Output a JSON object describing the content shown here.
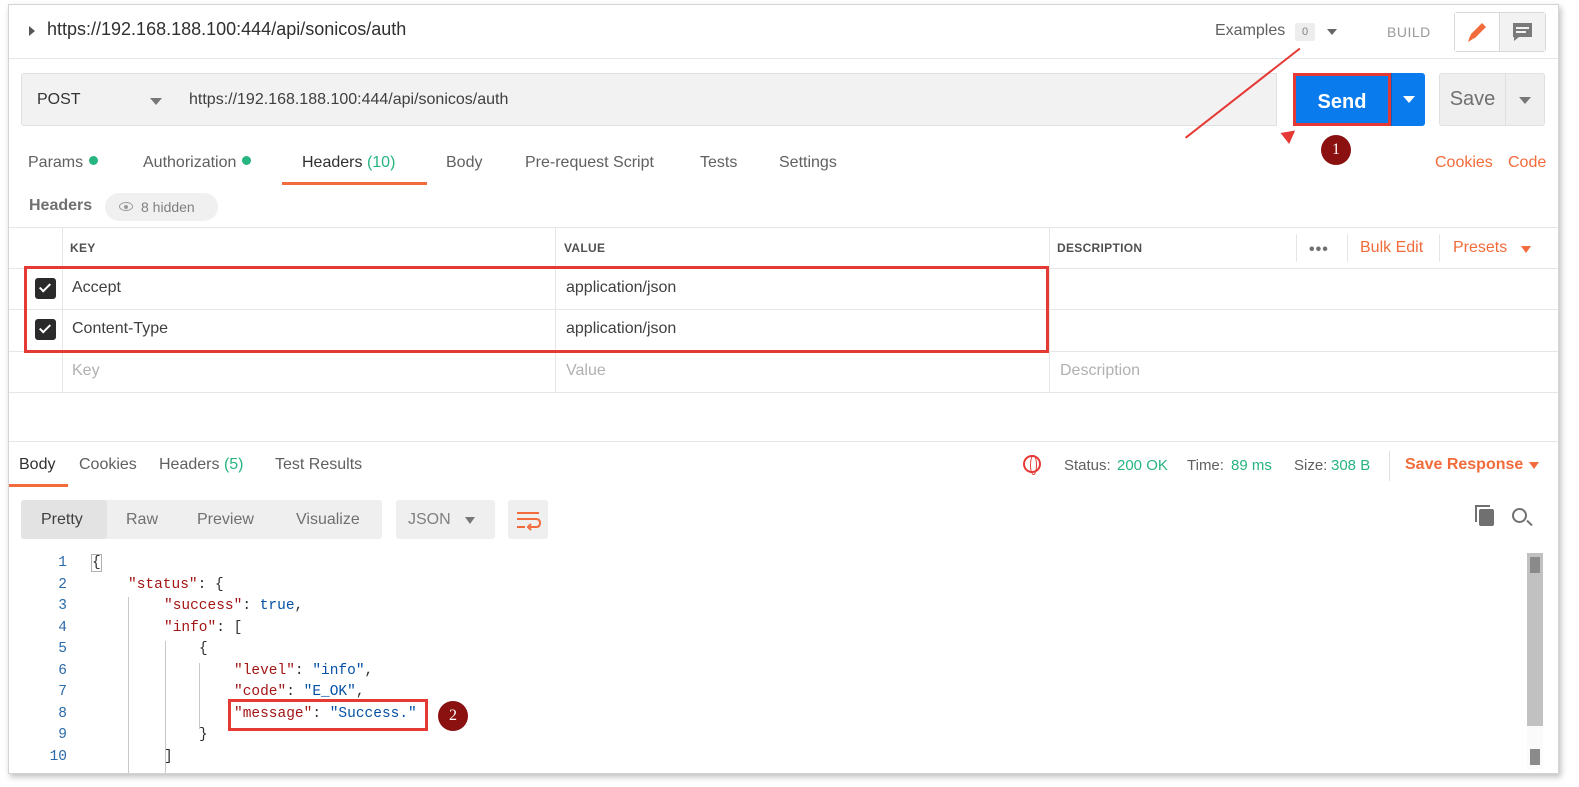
{
  "titlebar": {
    "url": "https://192.168.188.100:444/api/sonicos/auth",
    "examples_label": "Examples",
    "examples_count": "0",
    "build_label": "BUILD"
  },
  "request": {
    "method": "POST",
    "url": "https://192.168.188.100:444/api/sonicos/auth",
    "send_label": "Send",
    "save_label": "Save"
  },
  "annotations": {
    "one": "1",
    "two": "2"
  },
  "tabs": {
    "params": "Params",
    "authorization": "Authorization",
    "headers": "Headers",
    "headers_count": "(10)",
    "body": "Body",
    "pre_request": "Pre-request Script",
    "tests": "Tests",
    "settings": "Settings",
    "cookies_link": "Cookies",
    "code_link": "Code"
  },
  "headers_section": {
    "title": "Headers",
    "hidden": "8 hidden",
    "columns": {
      "key": "KEY",
      "value": "VALUE",
      "description": "DESCRIPTION"
    },
    "bulk_edit": "Bulk Edit",
    "presets": "Presets",
    "rows": [
      {
        "key": "Accept",
        "value": "application/json",
        "checked": true
      },
      {
        "key": "Content-Type",
        "value": "application/json",
        "checked": true
      }
    ],
    "placeholders": {
      "key": "Key",
      "value": "Value",
      "description": "Description"
    }
  },
  "response": {
    "tabs": {
      "body": "Body",
      "cookies": "Cookies",
      "headers": "Headers",
      "headers_count": "(5)",
      "test_results": "Test Results"
    },
    "status_label": "Status:",
    "status_value": "200 OK",
    "time_label": "Time:",
    "time_value": "89 ms",
    "size_label": "Size:",
    "size_value": "308 B",
    "save_response": "Save Response",
    "formats": {
      "pretty": "Pretty",
      "raw": "Raw",
      "preview": "Preview",
      "visualize": "Visualize"
    },
    "language": "JSON"
  },
  "code": {
    "line_numbers": [
      "1",
      "2",
      "3",
      "4",
      "5",
      "6",
      "7",
      "8",
      "9",
      "10"
    ],
    "tokens": {
      "status": "\"status\"",
      "success": "\"success\"",
      "true": "true",
      "info": "\"info\"",
      "level": "\"level\"",
      "level_val": "\"info\"",
      "code": "\"code\"",
      "code_val": "\"E_OK\"",
      "message": "\"message\"",
      "message_val": "\"Success.\""
    }
  },
  "colors": {
    "send_blue": "#097bed",
    "accent_orange": "#f26b3a",
    "status_green": "#26b47f",
    "annotation_red": "#e53935",
    "badge_dark_red": "#8b1010"
  },
  "icons": [
    "caret-right-icon",
    "pencil-icon",
    "comment-icon",
    "eye-icon",
    "checkbox-icon",
    "globe-warning-icon",
    "wrap-lines-icon",
    "copy-icon",
    "search-icon"
  ]
}
